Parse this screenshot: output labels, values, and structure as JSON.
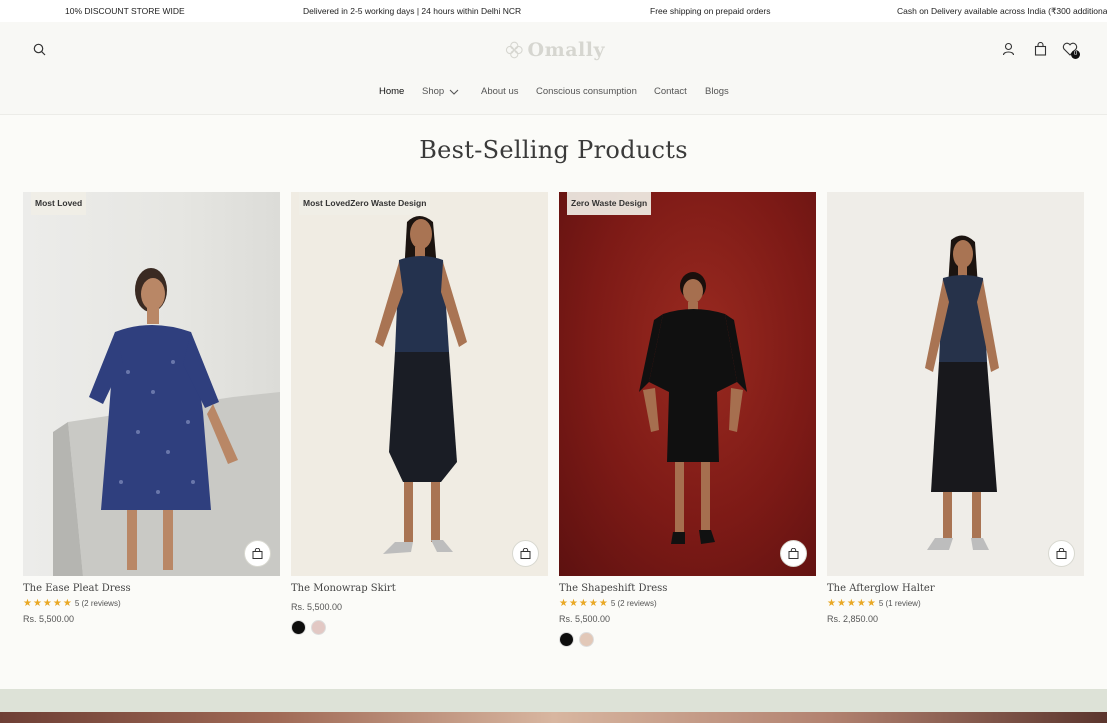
{
  "announcement": [
    "10% DISCOUNT STORE WIDE",
    "Delivered in 2-5 working days | 24 hours within Delhi NCR",
    "Free shipping on prepaid orders",
    "Cash on Delivery available across India (₹300 additional"
  ],
  "header": {
    "logo_text": "Omally",
    "wishlist_count": "0",
    "icons": [
      "search-icon",
      "user-icon",
      "bag-icon",
      "heart-icon"
    ]
  },
  "nav": [
    "Home",
    "Shop",
    "About us",
    "Conscious consumption",
    "Contact",
    "Blogs"
  ],
  "section": {
    "title": "Best-Selling Products"
  },
  "products": [
    {
      "tag": "Most Loved",
      "name": "The Ease Pleat Dress",
      "stars": "★★★★★",
      "reviews": "5 (2 reviews)",
      "price": "Rs. 5,500.00",
      "swatches": []
    },
    {
      "tag": "Most LovedZero Waste Design",
      "name": "The Monowrap Skirt",
      "stars": "",
      "reviews": "",
      "price": "Rs. 5,500.00",
      "swatches": [
        "#0d0d0d",
        "#e2c8c4"
      ]
    },
    {
      "tag": "Zero Waste Design",
      "name": "The Shapeshift Dress",
      "stars": "★★★★★",
      "reviews": "5 (2 reviews)",
      "price": "Rs. 5,500.00",
      "swatches": [
        "#0d0d0d",
        "#e2c8b8"
      ]
    },
    {
      "tag": "",
      "name": "The Afterglow Halter",
      "stars": "★★★★★",
      "reviews": "5 (1 review)",
      "price": "Rs. 2,850.00",
      "swatches": []
    }
  ],
  "colors": {
    "star": "#e9a825",
    "bg": "#fbfbf8",
    "footer_band": "#dde2d7"
  }
}
